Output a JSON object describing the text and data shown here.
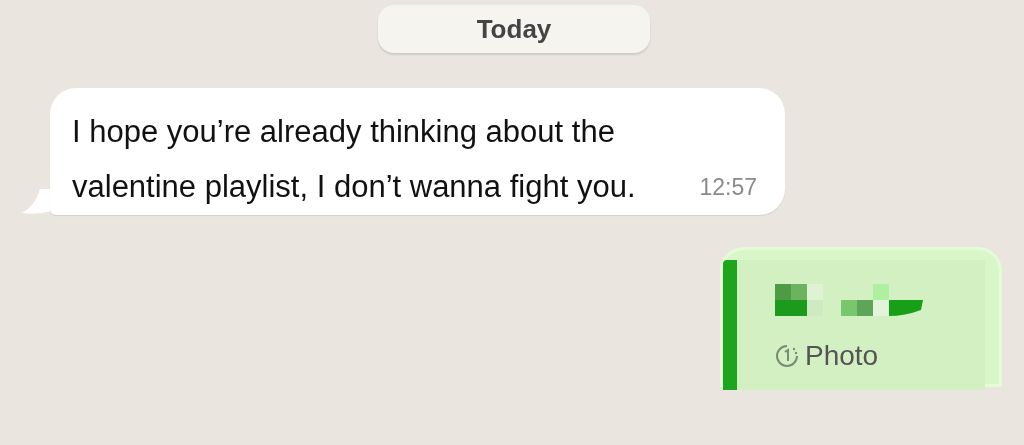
{
  "date_separator": "Today",
  "messages": [
    {
      "kind": "incoming",
      "text": "I hope you’re already thinking about the valentine playlist, I don’t wanna fight you.",
      "time": "12:57"
    },
    {
      "kind": "outgoing",
      "quote": {
        "label": "Photo"
      }
    }
  ]
}
